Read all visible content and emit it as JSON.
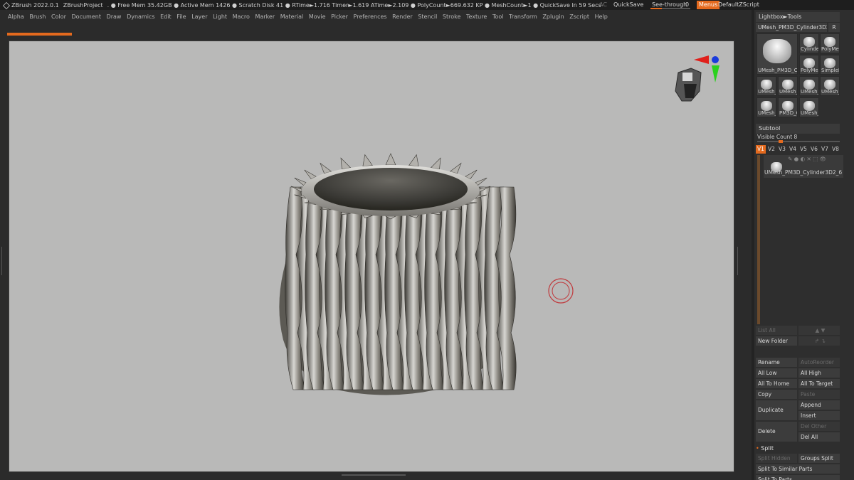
{
  "titlebar": {
    "app": "ZBrush 2022.0.1",
    "project": "ZBrushProject",
    "stats": ". ● Free Mem 35.42GB ● Active Mem 1426 ● Scratch Disk 41 ● RTime►1.716 Timer►1.619 ATime►2.109 ● PolyCount►669.632 KP ● MeshCount►1 ● QuickSave In 59 Secs",
    "ac": "AC",
    "quicksave": "QuickSave",
    "seethrough": "See-through",
    "seethrough_value": "0",
    "menus": "Menus",
    "script": "DefaultZScript"
  },
  "menubar": [
    "Alpha",
    "Brush",
    "Color",
    "Document",
    "Draw",
    "Dynamics",
    "Edit",
    "File",
    "Layer",
    "Light",
    "Macro",
    "Marker",
    "Material",
    "Movie",
    "Picker",
    "Preferences",
    "Render",
    "Stencil",
    "Stroke",
    "Texture",
    "Tool",
    "Transform",
    "Zplugin",
    "Zscript",
    "Help"
  ],
  "panel": {
    "lightbox_tools": "Lightbox►Tools",
    "current_tool": "UMesh_PM3D_Cylinder3D2_",
    "current_tool_r": "R",
    "main_thumb": "UMesh_PM3D_C",
    "thumbs": [
      "Cylinder",
      "PolyMes",
      "PolyMes",
      "SimpleB",
      "UMesh_",
      "UMesh_",
      "UMesh_",
      "UMesh_",
      "UMesh_",
      "PM3D_C",
      "UMesh_"
    ],
    "subtool_title": "Subtool",
    "visible_count": "Visible Count 8",
    "vtabs": [
      "V1",
      "V2",
      "V3",
      "V4",
      "V5",
      "V6",
      "V7",
      "V8"
    ],
    "subtool_item": "UMesh_PM3D_Cylinder3D2_6",
    "list_all": "List All",
    "new_folder": "New Folder",
    "buttons": {
      "rename": "Rename",
      "autoreorder": "AutoReorder",
      "all_low": "All Low",
      "all_high": "All High",
      "all_to_home": "All To Home",
      "all_to_target": "All To Target",
      "copy": "Copy",
      "paste": "Paste",
      "duplicate": "Duplicate",
      "append": "Append",
      "insert": "Insert",
      "delete": "Delete",
      "del_other": "Del Other",
      "del_all": "Del All"
    },
    "split_title": "Split",
    "split_hidden": "Split Hidden",
    "groups_split": "Groups Split",
    "split_similar": "Split To Similar Parts",
    "split_parts": "Split To Parts"
  },
  "colors": {
    "accent": "#e46a1e",
    "canvas": "#b9b9b8",
    "ui_dark": "#2b2b2b"
  }
}
